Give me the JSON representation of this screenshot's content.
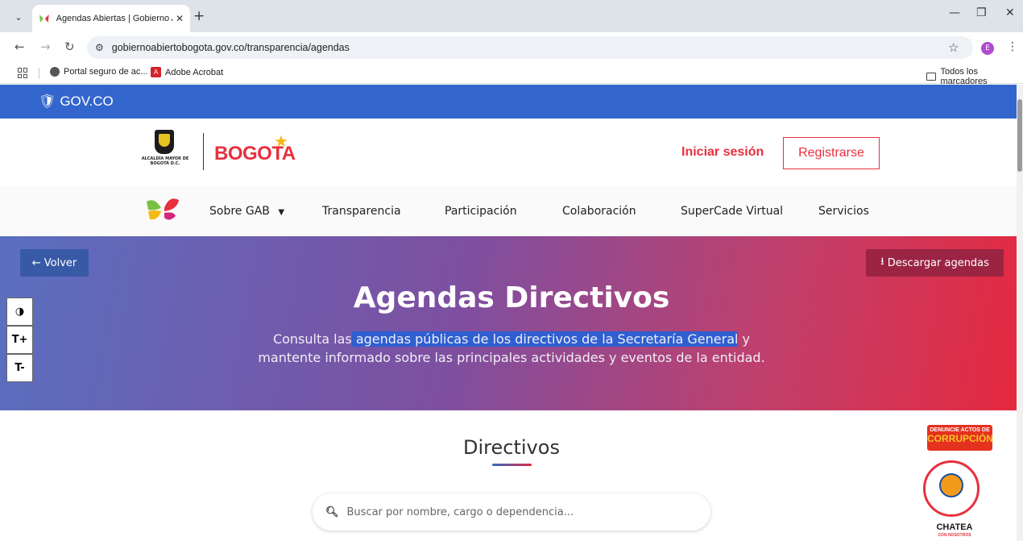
{
  "browser": {
    "tab_title": "Agendas Abiertas | Gobierno Ab",
    "tab_close": "✕",
    "new_tab": "+",
    "url": "gobiernoabiertobogota.gov.co/transparencia/agendas",
    "profile_initial": "E",
    "bookmarks": {
      "items": [
        {
          "label": "Portal seguro de ac..."
        },
        {
          "label": "Adobe Acrobat"
        }
      ],
      "all_bookmarks": "Todos los marcadores"
    }
  },
  "gov_bar": {
    "logo": "GOV.CO"
  },
  "header": {
    "alcaldia_caption": "ALCALDÍA MAYOR DE BOGOTÁ D.C.",
    "brand": "BOGOTA",
    "login": "Iniciar sesión",
    "register": "Registrarse"
  },
  "nav": {
    "items": [
      {
        "label": "Sobre GAB"
      },
      {
        "label": "Transparencia"
      },
      {
        "label": "Participación"
      },
      {
        "label": "Colaboración"
      },
      {
        "label": "SuperCade Virtual"
      },
      {
        "label": "Servicios"
      }
    ]
  },
  "hero": {
    "back": "Volver",
    "download": "Descargar agendas",
    "title": "Agendas Directivos",
    "subtitle_pre": "Consulta las",
    "subtitle_highlight": " agendas públicas de los directivos de la Secretaría General",
    "subtitle_post": " y",
    "subtitle_line2": "mantente informado sobre las principales actividades y eventos de la entidad."
  },
  "accessibility": {
    "contrast": "◑",
    "text_increase": "T+",
    "text_decrease": "T-"
  },
  "directivos": {
    "title": "Directivos",
    "search_placeholder": "Buscar por nombre, cargo o dependencia..."
  },
  "widgets": {
    "corruption_line1": "DENUNCIE ACTOS DE",
    "corruption_line2": "CORRUPCIÓN",
    "chat_line1": "CHATEA",
    "chat_line2": "CON NOSOTROS"
  },
  "colors": {
    "gov_blue": "#3366cc",
    "brand_red": "#e8303e",
    "hero_gradient_start": "#5a6fc0",
    "hero_gradient_end": "#e5293f",
    "download_button": "#9b2443",
    "highlight": "#2f5fd0"
  }
}
